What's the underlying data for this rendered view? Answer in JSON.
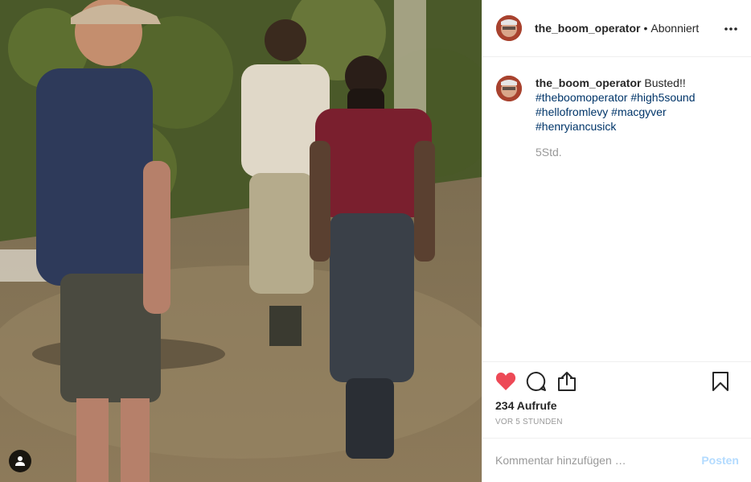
{
  "post": {
    "username": "the_boom_operator",
    "separator": "•",
    "follow_status": "Abonniert",
    "more_icon": "more-options-icon"
  },
  "caption": {
    "username": "the_boom_operator",
    "text": "Busted!!",
    "hashtags": [
      "#theboomoperator",
      "#high5sound",
      "#hellofromlevy",
      "#macgyver",
      "#henryiancusick"
    ],
    "time_ago": "5Std."
  },
  "actions": {
    "like_icon": "heart-filled-icon",
    "comment_icon": "comment-icon",
    "share_icon": "share-icon",
    "save_icon": "bookmark-icon",
    "like_color": "#ed4956",
    "views": "234 Aufrufe",
    "date": "VOR 5 STUNDEN"
  },
  "comment": {
    "placeholder": "Kommentar hinzufügen …",
    "post_label": "Posten"
  },
  "media": {
    "user_tag_icon": "person-icon",
    "description_colors": [
      "#4a5d2a",
      "#8a7a5a",
      "#2e3a5a",
      "#7a1f2e"
    ]
  }
}
